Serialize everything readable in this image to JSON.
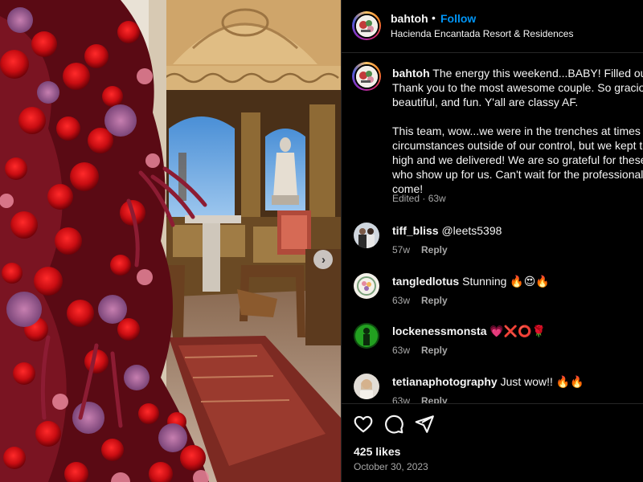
{
  "post": {
    "username": "bahtoh",
    "separator": "•",
    "follow_label": "Follow",
    "location": "Hacienda Encantada Resort & Residences"
  },
  "caption": {
    "username": "bahtoh",
    "lines": [
      "The energy this weekend...BABY! Filled our",
      "Thank you to the most awesome couple. So graciou",
      "beautiful, and fun. Y'all are classy AF.",
      "This team, wow...we were in the trenches at times d",
      "circumstances outside of our control, but we kept th",
      "high and we delivered! We are so grateful for these",
      "who show up for us. Can't wait for the professional",
      "come!"
    ],
    "edited": "Edited",
    "age": "63w"
  },
  "comments": [
    {
      "username": "tiff_bliss",
      "text": "@leets5398",
      "age": "57w",
      "reply": "Reply",
      "avatar": "couple-photo"
    },
    {
      "username": "tangledlotus",
      "text": "Stunning 🔥😍🔥",
      "age": "63w",
      "reply": "Reply",
      "avatar": "floral-logo"
    },
    {
      "username": "lockenessmonsta",
      "text": "💗❌⭕🌹",
      "age": "63w",
      "reply": "Reply",
      "avatar": "green-figure"
    },
    {
      "username": "tetianaphotography",
      "text": "Just wow!! 🔥🔥",
      "age": "63w",
      "reply": "Reply",
      "avatar": "portrait-photo"
    }
  ],
  "actions": {
    "icons": [
      "heart-icon",
      "comment-icon",
      "share-icon"
    ],
    "likes": "425 likes",
    "date": "October 30, 2023"
  },
  "media": {
    "next_icon": "chevron-right-icon",
    "next_glyph": "›"
  },
  "colors": {
    "background": "#000000",
    "text": "#f5f5f5",
    "secondary": "#a8a8a8",
    "follow": "#0095f6",
    "divider": "#262626"
  }
}
